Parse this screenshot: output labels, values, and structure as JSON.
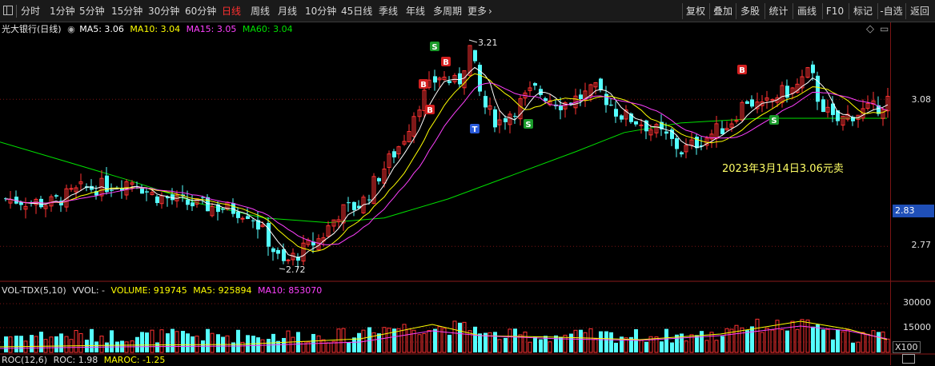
{
  "toolbar": {
    "periods": [
      "分时",
      "1分钟",
      "5分钟",
      "15分钟",
      "30分钟",
      "60分钟",
      "日线",
      "周线",
      "月线",
      "10分钟",
      "45日线",
      "季线",
      "年线",
      "多周期",
      "更多"
    ],
    "active_period": "日线",
    "right": [
      "复权",
      "叠加",
      "多股",
      "统计",
      "画线",
      "F10",
      "标记",
      "-自选",
      "返回"
    ]
  },
  "main_chart": {
    "stock_name": "光大银行(日线)",
    "ma5_label": "MA5: 3.06",
    "ma10_label": "MA10: 3.04",
    "ma15_label": "MA15: 3.05",
    "ma60_label": "MA60: 3.04",
    "high_label": "3.21",
    "low_label": "2.72",
    "annotation": "2023年3月14日3.06元卖",
    "price_ticks": [
      "3.08",
      "2.83",
      "2.77"
    ],
    "current_price": "2.83",
    "colors": {
      "ma5": "#ffffff",
      "ma10": "#ffff00",
      "ma15": "#ff40ff",
      "ma60": "#00e000",
      "up": "#ff3232",
      "down": "#54ffff",
      "grid": "#7a1414"
    }
  },
  "volume_chart": {
    "indicator": "VOL-TDX(5,10)",
    "vvol": "VVOL: -",
    "volume": "VOLUME: 919745",
    "ma5": "MA5: 925894",
    "ma10": "MA10: 853070",
    "ticks": [
      "30000",
      "15000"
    ],
    "unit": "X100"
  },
  "roc_chart": {
    "indicator": "ROC(12,6)",
    "roc": "ROC: 1.98",
    "maroc": "MAROC: -1.25"
  },
  "markers": {
    "buy": "B",
    "sell": "S",
    "t": "T"
  },
  "chart_data": {
    "type": "candlestick",
    "title": "光大银行(日线)",
    "ylim": [
      2.7,
      3.24
    ],
    "price_ticks": [
      3.08,
      2.83,
      2.77
    ],
    "high": 3.21,
    "low": 2.72,
    "close_last": 3.08,
    "series": [
      {
        "name": "MA5",
        "last": 3.06
      },
      {
        "name": "MA10",
        "last": 3.04
      },
      {
        "name": "MA15",
        "last": 3.05
      },
      {
        "name": "MA60",
        "last": 3.04
      }
    ],
    "volume": {
      "last": 919745,
      "ma5": 925894,
      "ma10": 853070,
      "ticks": [
        30000,
        15000
      ]
    },
    "roc": {
      "roc": 1.98,
      "maroc": -1.25
    }
  }
}
